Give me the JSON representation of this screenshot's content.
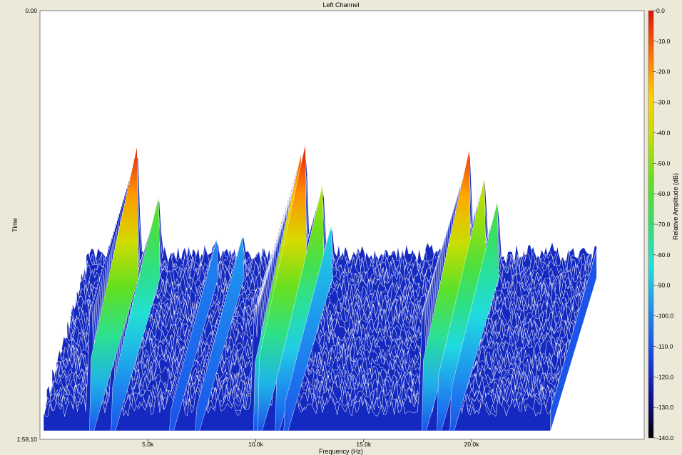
{
  "chart_data": {
    "type": "waterfall-spectrogram",
    "title": "Left Channel",
    "xlabel": "Frequency (Hz)",
    "ylabel": "Time",
    "colorbar_label": "Relative Amplitude (dB)",
    "x_ticks": [
      "5.0k",
      "10.0k",
      "15.0k",
      "20.0k"
    ],
    "x_tick_values": [
      5000,
      10000,
      15000,
      20000
    ],
    "xlim": [
      0,
      28000
    ],
    "y_ticks": [
      "0.00",
      "1:58.10"
    ],
    "colorbar_ticks": [
      "0.0",
      "-10.0",
      "-20.0",
      "-30.0",
      "-40.0",
      "-50.0",
      "-60.0",
      "-70.0",
      "-80.0",
      "-90.0",
      "-100.0",
      "-110.0",
      "-120.0",
      "-130.0",
      "-140.0"
    ],
    "colorbar_range": [
      -140,
      0
    ],
    "colorscale": [
      "#000000",
      "#1010a0",
      "#1a4ae8",
      "#1e8ff0",
      "#20e0e0",
      "#30e070",
      "#60e020",
      "#c0e000",
      "#ffd000",
      "#ff7000",
      "#e01010"
    ],
    "noise_floor_db": [
      -125,
      -100
    ],
    "peaks": [
      {
        "freq": 2200,
        "db": -2
      },
      {
        "freq": 3200,
        "db": -55
      },
      {
        "freq": 9800,
        "db": -10
      },
      {
        "freq": 10000,
        "db": 0
      },
      {
        "freq": 10800,
        "db": -42
      },
      {
        "freq": 11200,
        "db": -85
      },
      {
        "freq": 17600,
        "db": -5
      },
      {
        "freq": 18300,
        "db": -35
      },
      {
        "freq": 18900,
        "db": -60
      },
      {
        "freq": 7100,
        "db": -95
      },
      {
        "freq": 5900,
        "db": -100
      }
    ]
  }
}
